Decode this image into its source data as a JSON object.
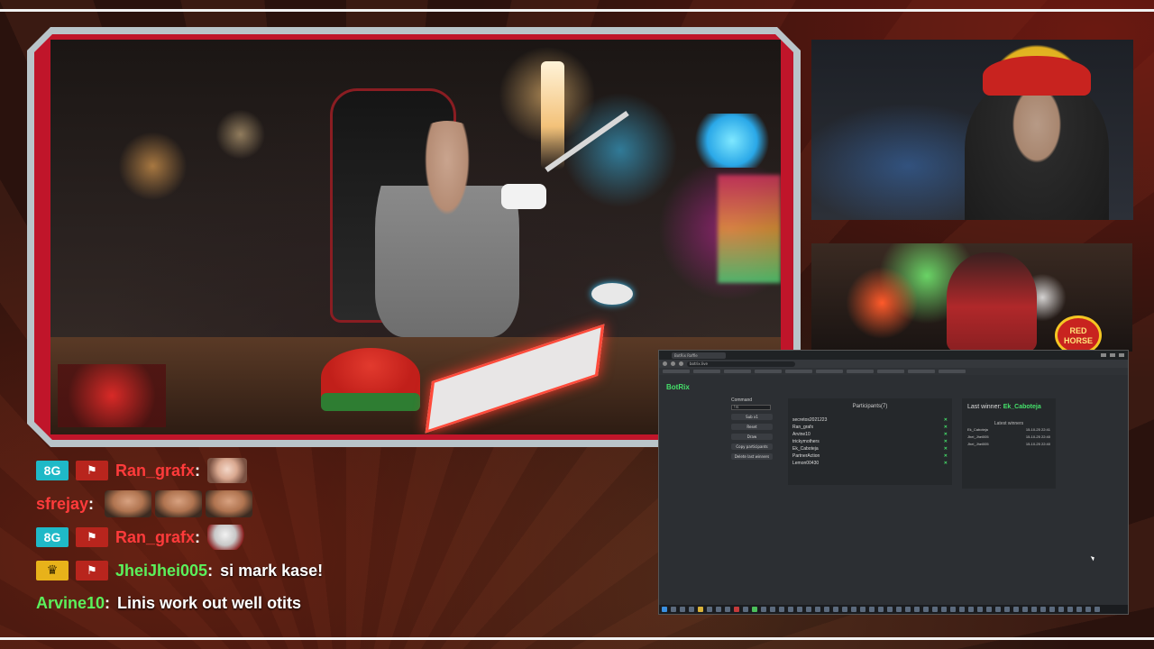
{
  "chat": {
    "messages": [
      {
        "badges": [
          "sub",
          "team"
        ],
        "user": "Ran_grafx",
        "user_color": "#ff3b3b",
        "text": "",
        "emotes": 1
      },
      {
        "badges": [],
        "user": "sfrejay",
        "user_color": "#ff3b3b",
        "text": "",
        "emotes": 3
      },
      {
        "badges": [
          "sub",
          "team"
        ],
        "user": "Ran_grafx",
        "user_color": "#ff3b3b",
        "text": "",
        "emotes": 1
      },
      {
        "badges": [
          "crown",
          "team"
        ],
        "user": "JheiJhei005",
        "user_color": "#5bf05b",
        "text": "si mark kase!"
      },
      {
        "badges": [],
        "user": "Arvine10",
        "user_color": "#5bf05b",
        "text": "Linis work out well otits"
      }
    ],
    "badge_sub_label": "8G"
  },
  "overlay": {
    "badge_text": "RED HORSE"
  },
  "browser": {
    "tab_title": "BotRix Raffle",
    "url": "botrix.live",
    "app_name": "BotRix",
    "command_label": "Command",
    "command_value": "!rs",
    "buttons": [
      "Sub x1",
      "Reset",
      "Draw",
      "Copy participants",
      "Delete last winners"
    ],
    "participants_title": "Participants(7)",
    "participants": [
      "secretos2021223",
      "Ran_grafx",
      "Arvine10",
      "trickymothers",
      "Ek_Caboteja",
      "PartnerAction",
      "Lemon00430"
    ],
    "last_winner_label": "Last winner:",
    "last_winner_name": "Ek_Caboteja",
    "latest_winners_title": "Latest winners",
    "latest_winners": [
      {
        "name": "Ek_Caboteja",
        "time": "15-10-25 22:41"
      },
      {
        "name": "Jhei_Jhei005",
        "time": "15-10-25 22:40"
      },
      {
        "name": "Jhei_Jhei005",
        "time": "15-10-25 22:40"
      }
    ]
  },
  "colors": {
    "frame_red": "#c0152a",
    "accent_green": "#45e06a",
    "sub_badge": "#1fb9c7"
  }
}
